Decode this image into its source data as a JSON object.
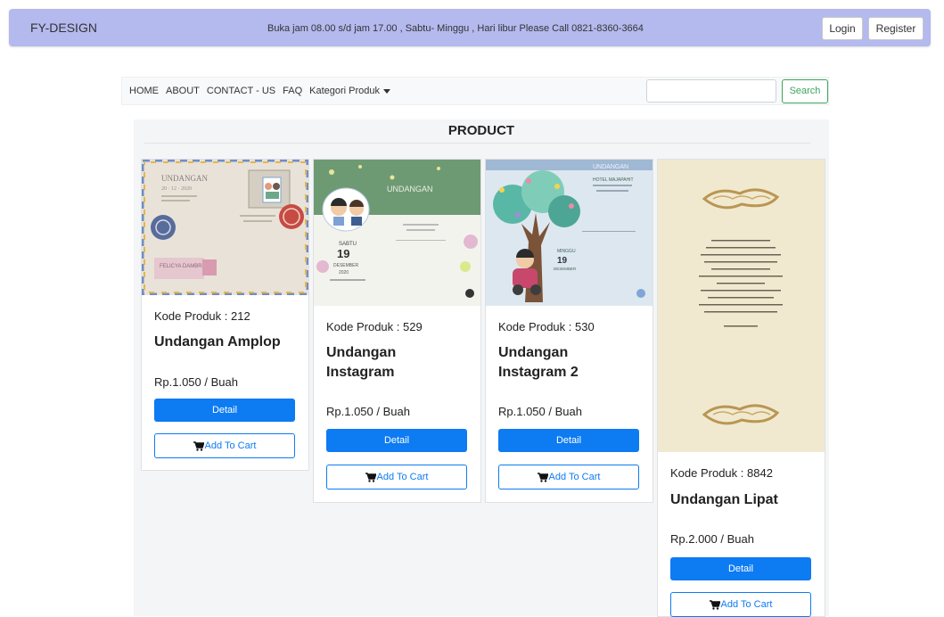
{
  "header": {
    "brand": "FY-DESIGN",
    "hours": "Buka jam 08.00 s/d jam 17.00 , Sabtu- Minggu , Hari libur Please Call 0821-8360-3664",
    "login_label": "Login",
    "register_label": "Register"
  },
  "nav": {
    "home": "HOME",
    "about": "ABOUT",
    "contact": "CONTACT - US",
    "faq": "FAQ",
    "kategori": "Kategori Produk",
    "search_value": "",
    "search_label": "Search"
  },
  "section": {
    "title": "PRODUCT"
  },
  "products": [
    {
      "code": "Kode Produk : 212",
      "name": "Undangan Amplop",
      "price": "Rp.1.050 / Buah",
      "detail": "Detail",
      "cart": "Add To Cart",
      "thumb_text": "UNDANGAN",
      "couple": "FELICYA DAMBRA"
    },
    {
      "code": "Kode Produk : 529",
      "name_line1": "Undangan",
      "name_line2": "Instagram",
      "price": "Rp.1.050 / Buah",
      "detail": "Detail",
      "cart": "Add To Cart",
      "thumb_text": "UNDANGAN",
      "day": "SABTU",
      "date": "19",
      "month": "DESEMBER",
      "year": "2020"
    },
    {
      "code": "Kode Produk : 530",
      "name_line1": "Undangan",
      "name_line2": "Instagram 2",
      "price": "Rp.1.050 / Buah",
      "detail": "Detail",
      "cart": "Add To Cart",
      "thumb_text": "UNDANGAN",
      "hotel": "HOTEL MAJAPAHIT",
      "day": "MINGGU",
      "date": "19",
      "month": "DESEMBER"
    },
    {
      "code": "Kode Produk : 8842",
      "name": "Undangan Lipat",
      "price": "Rp.2.000 / Buah",
      "detail": "Detail",
      "cart": "Add To Cart"
    }
  ],
  "colors": {
    "header_bg": "#b4b9ee",
    "primary": "#0d7bf2",
    "success": "#3ca55c"
  },
  "icons": [
    "cart-icon",
    "caret-down-icon"
  ]
}
